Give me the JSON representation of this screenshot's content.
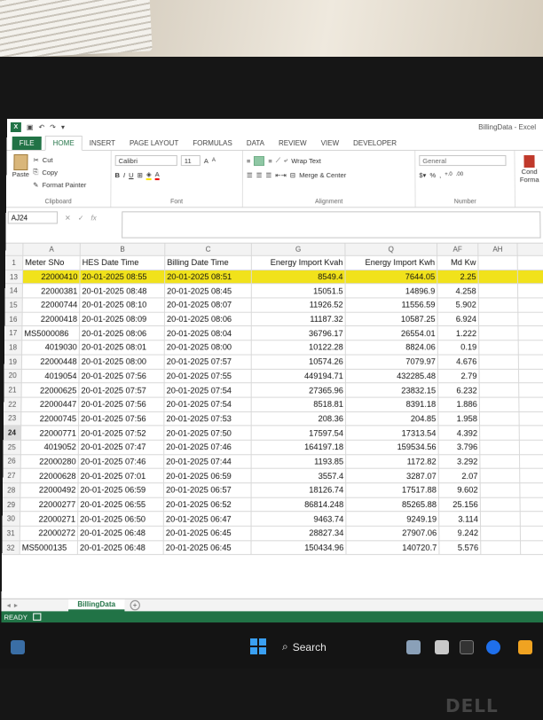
{
  "window": {
    "doc_title": "BillingData - Excel",
    "app_badge": "X"
  },
  "tabs": [
    "FILE",
    "HOME",
    "INSERT",
    "PAGE LAYOUT",
    "FORMULAS",
    "DATA",
    "REVIEW",
    "VIEW",
    "DEVELOPER"
  ],
  "ribbon": {
    "clipboard": {
      "paste": "Paste",
      "cut": "Cut",
      "copy": "Copy",
      "format_painter": "Format Painter",
      "label": "Clipboard"
    },
    "font": {
      "name": "Calibri",
      "size": "11",
      "label": "Font",
      "bold": "B",
      "italic": "I",
      "underline": "U",
      "grow": "A",
      "shrink": "A",
      "font_color": "A"
    },
    "alignment": {
      "wrap": "Wrap Text",
      "merge": "Merge & Center",
      "label": "Alignment"
    },
    "number": {
      "format": "General",
      "label": "Number",
      "percent": "%",
      "comma": ","
    },
    "styles": {
      "conditional": "Cond",
      "formatting": "Forma"
    }
  },
  "formula_bar": {
    "name_box": "AJ24",
    "fx": "fx",
    "value": ""
  },
  "columns": [
    "A",
    "B",
    "C",
    "G",
    "Q",
    "AF",
    "AH"
  ],
  "header_row": {
    "num": "1",
    "cells": [
      "Meter SNo",
      "HES Date Time",
      "Billing Date Time",
      "Energy Import Kvah",
      "Energy Import Kwh",
      "Md Kw",
      ""
    ]
  },
  "rows": [
    {
      "num": "13",
      "cells": [
        "22000410",
        "20-01-2025 08:55",
        "20-01-2025 08:51",
        "8549.4",
        "7644.05",
        "2.25"
      ]
    },
    {
      "num": "14",
      "cells": [
        "22000381",
        "20-01-2025 08:48",
        "20-01-2025 08:45",
        "15051.5",
        "14896.9",
        "4.258"
      ]
    },
    {
      "num": "15",
      "cells": [
        "22000744",
        "20-01-2025 08:10",
        "20-01-2025 08:07",
        "11926.52",
        "11556.59",
        "5.902"
      ]
    },
    {
      "num": "16",
      "cells": [
        "22000418",
        "20-01-2025 08:09",
        "20-01-2025 08:06",
        "11187.32",
        "10587.25",
        "6.924"
      ]
    },
    {
      "num": "17",
      "cells": [
        "MS5000086",
        "20-01-2025 08:06",
        "20-01-2025 08:04",
        "36796.17",
        "26554.01",
        "1.222"
      ]
    },
    {
      "num": "18",
      "cells": [
        "4019030",
        "20-01-2025 08:01",
        "20-01-2025 08:00",
        "10122.28",
        "8824.06",
        "0.19"
      ]
    },
    {
      "num": "19",
      "cells": [
        "22000448",
        "20-01-2025 08:00",
        "20-01-2025 07:57",
        "10574.26",
        "7079.97",
        "4.676"
      ]
    },
    {
      "num": "20",
      "cells": [
        "4019054",
        "20-01-2025 07:56",
        "20-01-2025 07:55",
        "449194.71",
        "432285.48",
        "2.79"
      ]
    },
    {
      "num": "21",
      "cells": [
        "22000625",
        "20-01-2025 07:57",
        "20-01-2025 07:54",
        "27365.96",
        "23832.15",
        "6.232"
      ]
    },
    {
      "num": "22",
      "cells": [
        "22000447",
        "20-01-2025 07:56",
        "20-01-2025 07:54",
        "8518.81",
        "8391.18",
        "1.886"
      ]
    },
    {
      "num": "23",
      "cells": [
        "22000745",
        "20-01-2025 07:56",
        "20-01-2025 07:53",
        "208.36",
        "204.85",
        "1.958"
      ]
    },
    {
      "num": "24",
      "cells": [
        "22000771",
        "20-01-2025 07:52",
        "20-01-2025 07:50",
        "17597.54",
        "17313.54",
        "4.392"
      ]
    },
    {
      "num": "25",
      "cells": [
        "4019052",
        "20-01-2025 07:47",
        "20-01-2025 07:46",
        "164197.18",
        "159534.56",
        "3.796"
      ]
    },
    {
      "num": "26",
      "cells": [
        "22000280",
        "20-01-2025 07:46",
        "20-01-2025 07:44",
        "1193.85",
        "1172.82",
        "3.292"
      ]
    },
    {
      "num": "27",
      "cells": [
        "22000628",
        "20-01-2025 07:01",
        "20-01-2025 06:59",
        "3557.4",
        "3287.07",
        "2.07"
      ]
    },
    {
      "num": "28",
      "cells": [
        "22000492",
        "20-01-2025 06:59",
        "20-01-2025 06:57",
        "18126.74",
        "17517.88",
        "9.602"
      ]
    },
    {
      "num": "29",
      "cells": [
        "22000277",
        "20-01-2025 06:55",
        "20-01-2025 06:52",
        "86814.248",
        "85265.88",
        "25.156"
      ]
    },
    {
      "num": "30",
      "cells": [
        "22000271",
        "20-01-2025 06:50",
        "20-01-2025 06:47",
        "9463.74",
        "9249.19",
        "3.114"
      ]
    },
    {
      "num": "31",
      "cells": [
        "22000272",
        "20-01-2025 06:48",
        "20-01-2025 06:45",
        "28827.34",
        "27907.06",
        "9.242"
      ]
    },
    {
      "num": "32",
      "cells": [
        "MS5000135",
        "20-01-2025 06:48",
        "20-01-2025 06:45",
        "150434.96",
        "140720.7",
        "5.576"
      ]
    }
  ],
  "sheet_tab": "BillingData",
  "status": "READY",
  "taskbar": {
    "search": "Search"
  },
  "brand": "DELL"
}
